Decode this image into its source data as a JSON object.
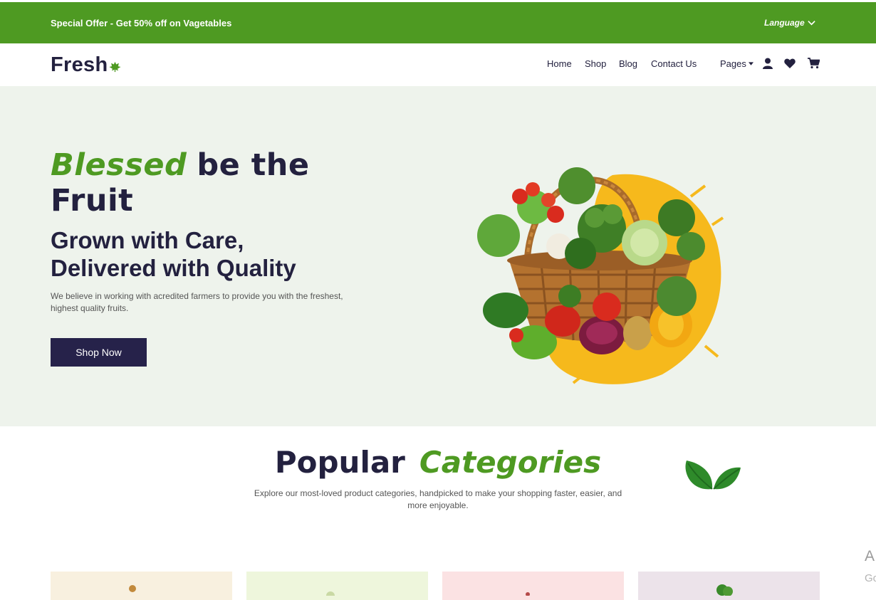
{
  "topbar": {
    "offer": "Special Offer - Get 50% off on Vagetables",
    "language": "Language"
  },
  "brand": {
    "name": "Fresh"
  },
  "nav": {
    "home": "Home",
    "shop": "Shop",
    "blog": "Blog",
    "contact": "Contact Us",
    "pages": "Pages"
  },
  "icons": [
    "user-icon",
    "heart-icon",
    "cart-icon",
    "chevron-down-icon",
    "leaf-icon"
  ],
  "hero": {
    "title_accent": "Blessed",
    "title_rest": "be the Fruit",
    "subtitle": "Grown with Care, Delivered with Quality",
    "description": "We believe in working with acredited farmers to provide you with the freshest, highest quality fruits.",
    "cta": "Shop Now"
  },
  "categories": {
    "title_part1": "Popular",
    "title_part2": "Categories",
    "description": "Explore our most-loved product categories, handpicked to make your shopping faster, easier, and more enjoyable."
  },
  "edge_text": {
    "a": "A",
    "b": "Go"
  },
  "colors": {
    "brand_green": "#4e9a22",
    "navy": "#23213f",
    "hero_bg": "#eef3ec",
    "button_bg": "#26224a"
  }
}
